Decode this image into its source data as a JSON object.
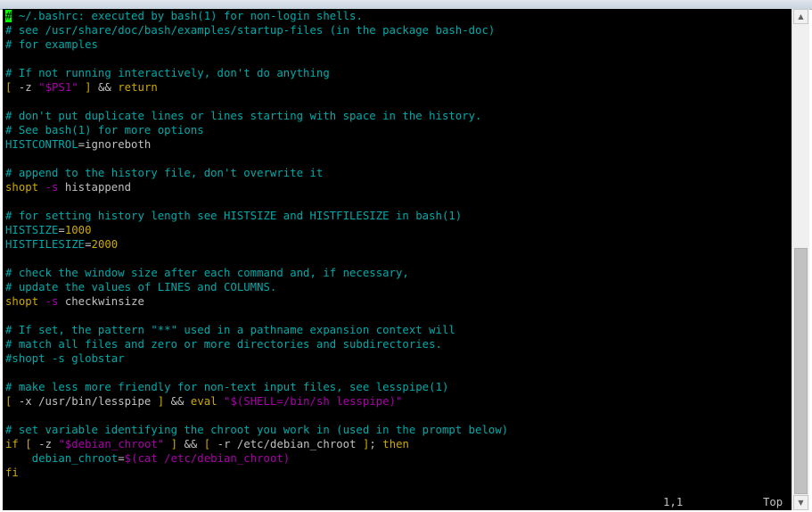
{
  "terminal": {
    "lines": [
      [
        {
          "t": "#",
          "c": "cursor"
        },
        {
          "t": " ~/.bashrc: executed by bash(1) for non-login shells.",
          "c": "comment"
        }
      ],
      [
        {
          "t": "# see /usr/share/doc/bash/examples/startup-files (in the package bash-doc)",
          "c": "comment"
        }
      ],
      [
        {
          "t": "# for examples",
          "c": "comment"
        }
      ],
      [],
      [
        {
          "t": "# If not running interactively, don't do anything",
          "c": "comment"
        }
      ],
      [
        {
          "t": "[",
          "c": "bracket"
        },
        {
          "t": " -z ",
          "c": "normal"
        },
        {
          "t": "\"$PS1\"",
          "c": "string"
        },
        {
          "t": " ] ",
          "c": "bracket"
        },
        {
          "t": "&& ",
          "c": "normal"
        },
        {
          "t": "return",
          "c": "keyword"
        }
      ],
      [],
      [
        {
          "t": "# don't put duplicate lines or lines starting with space in the history.",
          "c": "comment"
        }
      ],
      [
        {
          "t": "# See bash(1) for more options",
          "c": "comment"
        }
      ],
      [
        {
          "t": "HISTCONTROL",
          "c": "var"
        },
        {
          "t": "=ignoreboth",
          "c": "normal"
        }
      ],
      [],
      [
        {
          "t": "# append to the history file, don't overwrite it",
          "c": "comment"
        }
      ],
      [
        {
          "t": "shopt",
          "c": "builtin"
        },
        {
          "t": " -s",
          "c": "flag"
        },
        {
          "t": " histappend",
          "c": "normal"
        }
      ],
      [],
      [
        {
          "t": "# for setting history length see HISTSIZE and HISTFILESIZE in bash(1)",
          "c": "comment"
        }
      ],
      [
        {
          "t": "HISTSIZE",
          "c": "var"
        },
        {
          "t": "=",
          "c": "normal"
        },
        {
          "t": "1000",
          "c": "number"
        }
      ],
      [
        {
          "t": "HISTFILESIZE",
          "c": "var"
        },
        {
          "t": "=",
          "c": "normal"
        },
        {
          "t": "2000",
          "c": "number"
        }
      ],
      [],
      [
        {
          "t": "# check the window size after each command and, if necessary,",
          "c": "comment"
        }
      ],
      [
        {
          "t": "# update the values of LINES and COLUMNS.",
          "c": "comment"
        }
      ],
      [
        {
          "t": "shopt",
          "c": "builtin"
        },
        {
          "t": " -s",
          "c": "flag"
        },
        {
          "t": " checkwinsize",
          "c": "normal"
        }
      ],
      [],
      [
        {
          "t": "# If set, the pattern \"**\" used in a pathname expansion context will",
          "c": "comment"
        }
      ],
      [
        {
          "t": "# match all files and zero or more directories and subdirectories.",
          "c": "comment"
        }
      ],
      [
        {
          "t": "#shopt -s globstar",
          "c": "comment"
        }
      ],
      [],
      [
        {
          "t": "# make less more friendly for non-text input files, see lesspipe(1)",
          "c": "comment"
        }
      ],
      [
        {
          "t": "[",
          "c": "bracket"
        },
        {
          "t": " -x /usr/bin/lesspipe ",
          "c": "normal"
        },
        {
          "t": "] ",
          "c": "bracket"
        },
        {
          "t": "&& ",
          "c": "normal"
        },
        {
          "t": "eval",
          "c": "builtin"
        },
        {
          "t": " \"$(SHELL=/bin/sh lesspipe)\"",
          "c": "string"
        }
      ],
      [],
      [
        {
          "t": "# set variable identifying the chroot you work in (used in the prompt below)",
          "c": "comment"
        }
      ],
      [
        {
          "t": "if",
          "c": "keyword"
        },
        {
          "t": " ",
          "c": "normal"
        },
        {
          "t": "[",
          "c": "bracket"
        },
        {
          "t": " -z ",
          "c": "normal"
        },
        {
          "t": "\"$debian_chroot\"",
          "c": "string"
        },
        {
          "t": " ] ",
          "c": "bracket"
        },
        {
          "t": "&& ",
          "c": "normal"
        },
        {
          "t": "[",
          "c": "bracket"
        },
        {
          "t": " -r /etc/debian_chroot ",
          "c": "normal"
        },
        {
          "t": "]",
          "c": "bracket"
        },
        {
          "t": "; ",
          "c": "normal"
        },
        {
          "t": "then",
          "c": "keyword"
        }
      ],
      [
        {
          "t": "    debian_chroot",
          "c": "var"
        },
        {
          "t": "=",
          "c": "normal"
        },
        {
          "t": "$(cat /etc/debian_chroot)",
          "c": "string"
        }
      ],
      [
        {
          "t": "fi",
          "c": "keyword"
        }
      ]
    ],
    "colors": {
      "background": "#000000",
      "comment": "#00aaaa",
      "keyword": "#cdaa00",
      "string": "#aa00aa",
      "cursor": "#00ff00"
    }
  },
  "status": {
    "position": "1,1",
    "scroll": "Top"
  },
  "scrollbar": {
    "up_icon": "arrow-up-icon",
    "down_icon": "arrow-down-icon"
  }
}
